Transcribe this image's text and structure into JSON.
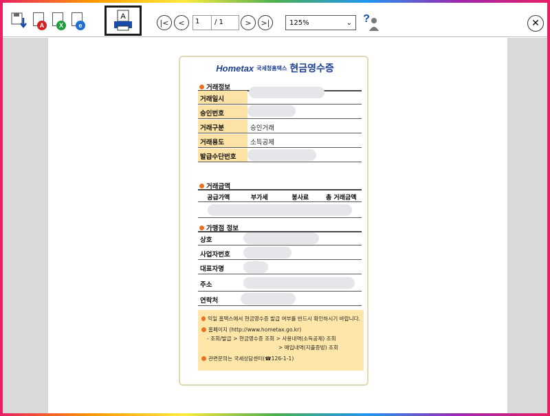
{
  "toolbar": {
    "save_icon": "save-download-icon",
    "pdf_icon": "pdf-export-icon",
    "excel_icon": "excel-export-icon",
    "hwp_icon": "hwp-export-icon",
    "print_label": "A",
    "current_page": "1",
    "total_pages": "/ 1",
    "zoom": "125%",
    "help": "?"
  },
  "receipt": {
    "logo": "Hometax",
    "logo_sub": "국세청홈택스",
    "title": "현금영수증",
    "section_transaction": "거래정보",
    "tx_rows": [
      {
        "label": "거래일시",
        "value": ""
      },
      {
        "label": "승인번호",
        "value": ""
      },
      {
        "label": "거래구분",
        "value": "승인거래"
      },
      {
        "label": "거래용도",
        "value": "소득공제"
      },
      {
        "label": "발급수단번호",
        "value": ""
      }
    ],
    "section_amount": "거래금액",
    "amount_headers": [
      "공급가액",
      "부가세",
      "봉사료",
      "총 거래금액"
    ],
    "section_merchant": "가맹점 정보",
    "merchant_rows": [
      {
        "label": "상호",
        "value": ""
      },
      {
        "label": "사업자번호",
        "value": ""
      },
      {
        "label": "대표자명",
        "value": ""
      },
      {
        "label": "주소",
        "value": ""
      },
      {
        "label": "연락처",
        "value": ""
      }
    ],
    "notes": {
      "line1": "익일 홈택스에서 현금영수증 발급 여부를 반드시 확인하시기 바랍니다.",
      "line2": "홈페이지 (http://www.hometax.go.kr)",
      "line3": "- 조회/발급 > 현금영수증 조회 > 사용내역(소득공제) 조회",
      "line4": "> 매입내역(지출증빙) 조회",
      "line5": "관련문의는 국세상담센터(☎126-1-1)"
    }
  },
  "colors": {
    "label_bg": "#fde2a5",
    "note_bg": "#fde6a8",
    "bullet": "#e8721f",
    "title": "#1c3f94"
  }
}
